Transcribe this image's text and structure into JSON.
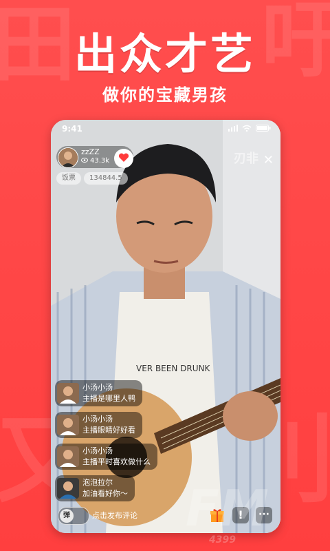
{
  "promo": {
    "headline": "出众才艺",
    "subline": "做你的宝藏男孩",
    "bg_chars": [
      "田",
      "吁",
      "又",
      "刂"
    ]
  },
  "status_bar": {
    "time": "9:41",
    "icons": [
      "signal-icon",
      "wifi-icon",
      "battery-icon"
    ]
  },
  "host": {
    "name": "zzZZ",
    "views": "43.3k",
    "follow_icon": "heart-icon"
  },
  "stats": {
    "label": "饭票",
    "value": "134844.5"
  },
  "close_label": "✕",
  "watermark_top": "刃非",
  "chat": {
    "messages": [
      {
        "name": "小汤小汤",
        "text": "主播是哪里人鸭"
      },
      {
        "name": "小汤小汤",
        "text": "主播眼睛好好看"
      },
      {
        "name": "小汤小汤",
        "text": "主播平时喜欢做什么"
      },
      {
        "name": "泡泡拉尔",
        "text": "加油看好你～"
      }
    ]
  },
  "bottom_bar": {
    "danmu_label": "弹",
    "comment_placeholder": "点击发布评论",
    "report_label": "!",
    "more_label": "···",
    "gift_icon": "gift-icon"
  },
  "corner_watermark": {
    "big": "FM",
    "small": "4399"
  },
  "colors": {
    "brand_red": "#ff4a4a",
    "follow_heart": "#ff3b3b"
  }
}
